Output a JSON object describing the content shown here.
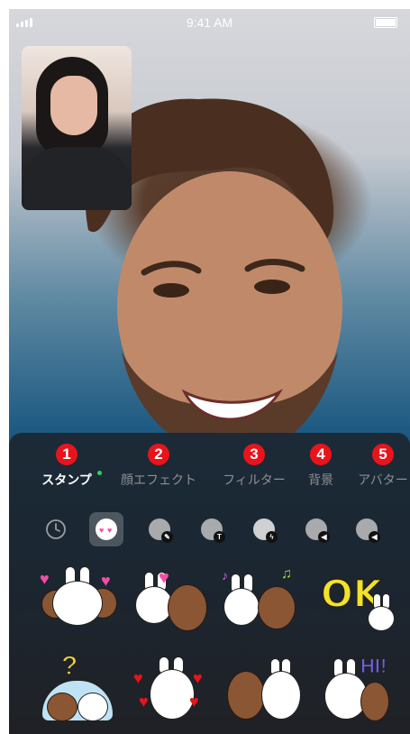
{
  "status": {
    "time": "9:41 AM"
  },
  "tabs": [
    {
      "number": "1",
      "label": "スタンプ",
      "active": true
    },
    {
      "number": "2",
      "label": "顔エフェクト",
      "active": false
    },
    {
      "number": "3",
      "label": "フィルター",
      "active": false
    },
    {
      "number": "4",
      "label": "背景",
      "active": false
    },
    {
      "number": "5",
      "label": "アバター",
      "active": false
    }
  ],
  "packs": [
    {
      "icon": "clock-icon",
      "selected": false
    },
    {
      "icon": "cony-pack-icon",
      "selected": true
    },
    {
      "icon": "brown-edit-pack-icon",
      "badge": "pencil",
      "selected": false
    },
    {
      "icon": "brown-text-pack-icon",
      "badge": "T",
      "selected": false
    },
    {
      "icon": "cony-flash-pack-icon",
      "badge": "bolt",
      "selected": false
    },
    {
      "icon": "brown-sound-pack-icon",
      "badge": "sound",
      "selected": false
    },
    {
      "icon": "brown-sound2-pack-icon",
      "badge": "sound",
      "selected": false
    }
  ],
  "stickers": {
    "ok_text": "OK",
    "hi_text": "HI!",
    "question_mark": "?"
  },
  "colors": {
    "badge_red": "#e8141c",
    "active_dot": "#2bd35a",
    "panel": "#1c1e22"
  }
}
